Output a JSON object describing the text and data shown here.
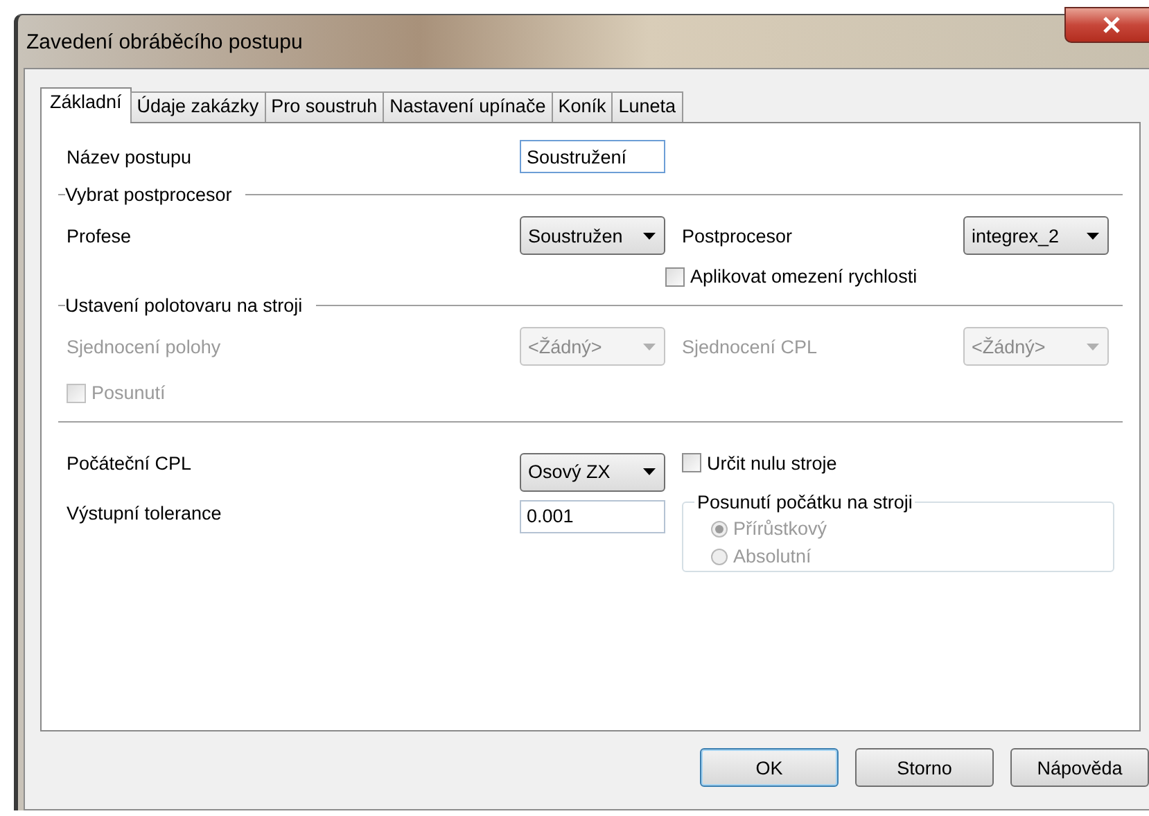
{
  "window": {
    "title": "Zavedení obráběcího postupu"
  },
  "tabs": [
    {
      "label": "Základní",
      "selected": true
    },
    {
      "label": "Údaje zakázky",
      "selected": false
    },
    {
      "label": "Pro soustruh",
      "selected": false
    },
    {
      "label": "Nastavení upínače",
      "selected": false
    },
    {
      "label": "Koník",
      "selected": false
    },
    {
      "label": "Luneta",
      "selected": false
    }
  ],
  "procedure_name": {
    "label": "Název postupu",
    "value": "Soustružení"
  },
  "postprocessor_section": {
    "title": "Vybrat postprocesor",
    "profession": {
      "label": "Profese",
      "value": "Soustružen",
      "disabled": false
    },
    "postprocessor": {
      "label": "Postprocesor",
      "value": "integrex_2",
      "disabled": false
    },
    "speed_limit": {
      "label": "Aplikovat omezení rychlosti",
      "checked": false,
      "disabled": false
    }
  },
  "setup_section": {
    "title": "Ustavení polotovaru na stroji",
    "position_merge": {
      "label": "Sjednocení polohy",
      "value": "<Žádný>",
      "disabled": true
    },
    "cpl_merge": {
      "label": "Sjednocení CPL",
      "value": "<Žádný>",
      "disabled": true
    },
    "shift": {
      "label": "Posunutí",
      "checked": false,
      "disabled": true
    }
  },
  "start_cpl": {
    "label": "Počáteční CPL",
    "value": "Osový ZX",
    "disabled": false
  },
  "machine_zero": {
    "label": "Určit nulu stroje",
    "checked": false,
    "disabled": false
  },
  "tolerance": {
    "label": "Výstupní tolerance",
    "value": "0.001"
  },
  "origin_shift": {
    "title": "Posunutí počátku na stroji",
    "options": [
      {
        "label": "Přírůstkový",
        "selected": true,
        "disabled": true
      },
      {
        "label": "Absolutní",
        "selected": false,
        "disabled": true
      }
    ]
  },
  "buttons": [
    {
      "label": "OK",
      "default": true
    },
    {
      "label": "Storno",
      "default": false
    },
    {
      "label": "Nápověda",
      "default": false
    }
  ]
}
